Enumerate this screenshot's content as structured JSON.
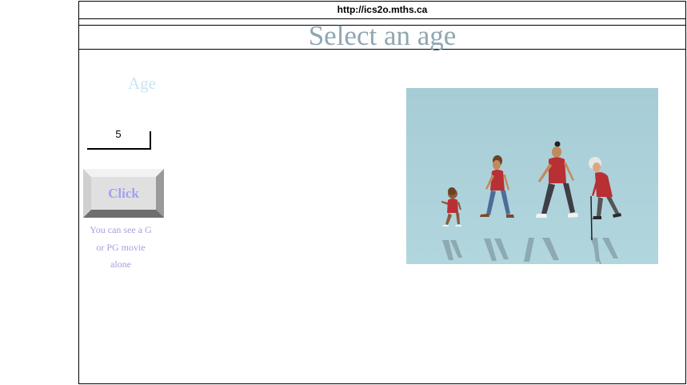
{
  "browser": {
    "url": "http://ics2o.mths.ca"
  },
  "page": {
    "title": "Select an age"
  },
  "form": {
    "age_label": "Age",
    "age_value": "5",
    "button_label": "Click",
    "result": "You can see a G or PG movie alone"
  },
  "image": {
    "alt": "Child, teen, woman and elderly person walking in a line"
  },
  "colors": {
    "title": "#8fa7b3",
    "age_label": "#c9e4f4",
    "button_text": "#a3a0ee",
    "result_text": "#a39fe0",
    "image_background": "#a8cfd9",
    "shirt_red": "#b83034"
  }
}
